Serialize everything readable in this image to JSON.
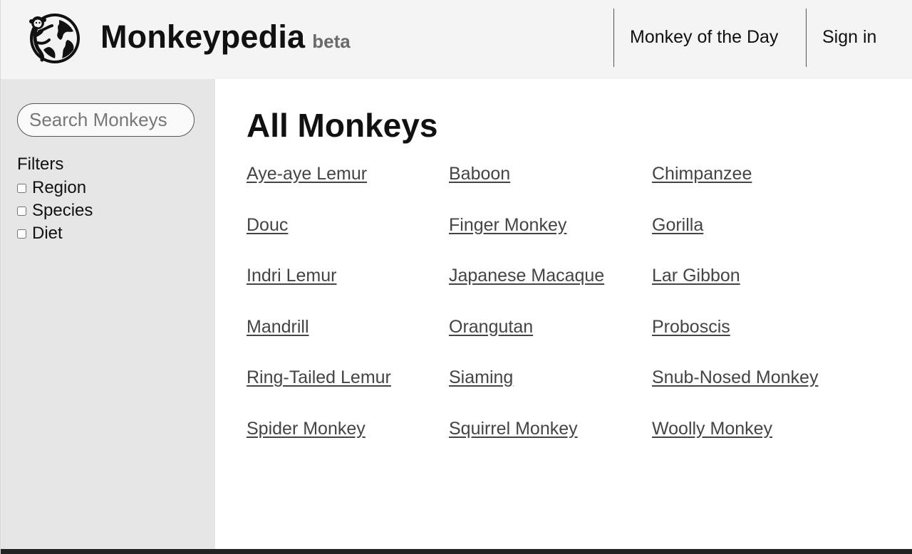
{
  "header": {
    "brand_name": "Monkeypedia",
    "brand_tag": "beta",
    "nav": [
      {
        "label": "Monkey of the Day"
      },
      {
        "label": "Sign in"
      }
    ]
  },
  "sidebar": {
    "search_placeholder": "Search Monkeys",
    "filters_title": "Filters",
    "filters": [
      {
        "label": "Region",
        "checked": false
      },
      {
        "label": "Species",
        "checked": false
      },
      {
        "label": "Diet",
        "checked": false
      }
    ]
  },
  "main": {
    "title": "All Monkeys",
    "monkeys": [
      "Aye-aye Lemur",
      "Baboon",
      "Chimpanzee",
      "Douc",
      "Finger Monkey",
      "Gorilla",
      "Indri Lemur",
      "Japanese Macaque",
      "Lar Gibbon",
      "Mandrill",
      "Orangutan",
      "Proboscis",
      "Ring-Tailed Lemur",
      "Siaming",
      "Snub-Nosed Monkey",
      "Spider Monkey",
      "Squirrel Monkey",
      "Woolly Monkey"
    ]
  },
  "icons": {
    "logo": "monkey-globe-icon"
  },
  "colors": {
    "header_bg": "#f4f4f4",
    "sidebar_bg": "#e6e6e6",
    "link": "#444444"
  }
}
